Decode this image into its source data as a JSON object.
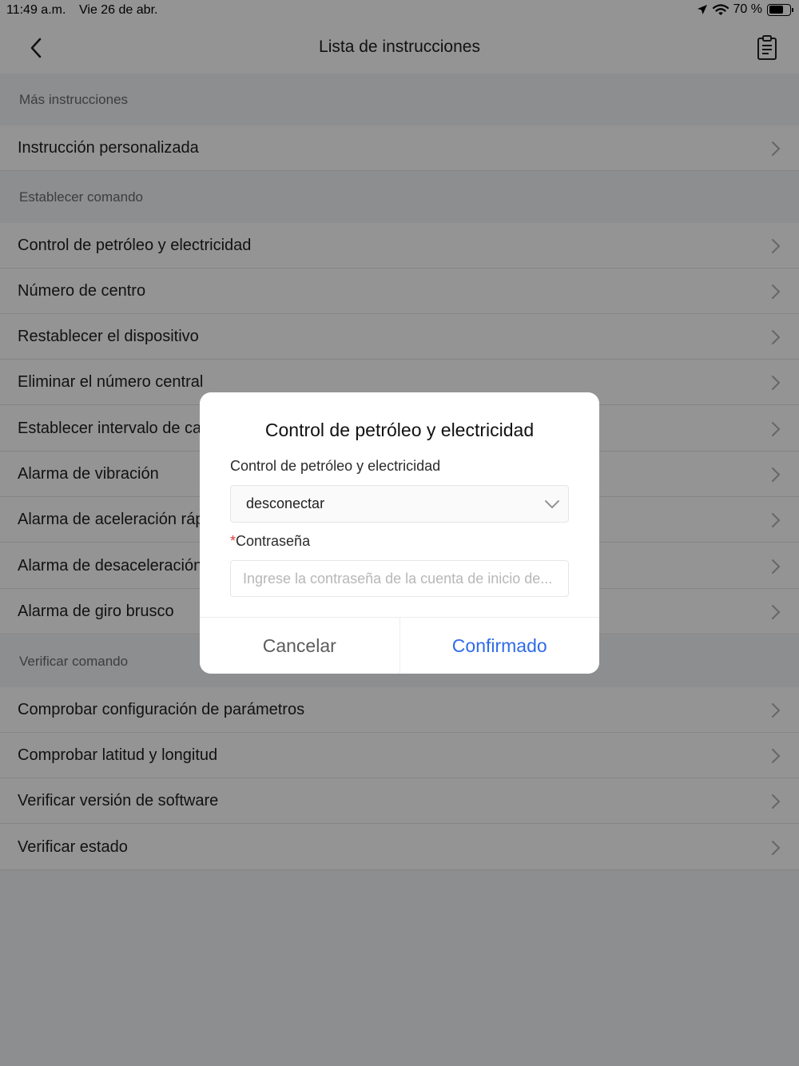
{
  "status_bar": {
    "time": "11:49 a.m.",
    "date": "Vie 26 de abr.",
    "battery": "70 %",
    "battery_level": 0.7
  },
  "nav": {
    "title": "Lista de instrucciones",
    "back_icon": "chevron-left-icon",
    "action_icon": "clipboard-list-icon"
  },
  "sections": [
    {
      "header": "Más instrucciones",
      "items": [
        "Instrucción personalizada"
      ]
    },
    {
      "header": "Establecer comando",
      "items": [
        "Control de petróleo y electricidad",
        "Número de centro",
        "Restablecer el dispositivo",
        "Eliminar el número central",
        "Establecer intervalo de carga",
        "Alarma de vibración",
        "Alarma de aceleración rápida",
        "Alarma de desaceleración rápida",
        "Alarma de giro brusco"
      ]
    },
    {
      "header": "Verificar comando",
      "items": [
        "Comprobar configuración de parámetros",
        "Comprobar latitud y longitud",
        "Verificar versión de software",
        "Verificar estado"
      ]
    }
  ],
  "dialog": {
    "title": "Control de petróleo y electricidad",
    "field_label": "Control de petróleo y electricidad",
    "select_value": "desconectar",
    "password_required_mark": "*",
    "password_label": "Contraseña",
    "password_placeholder": "Ingrese la contraseña de la cuenta de inicio de...",
    "password_value": "",
    "cancel": "Cancelar",
    "confirm": "Confirmado"
  },
  "colors": {
    "accent": "#2f6be8",
    "required": "#e23b3b",
    "section_bg": "#f3f4f6"
  }
}
